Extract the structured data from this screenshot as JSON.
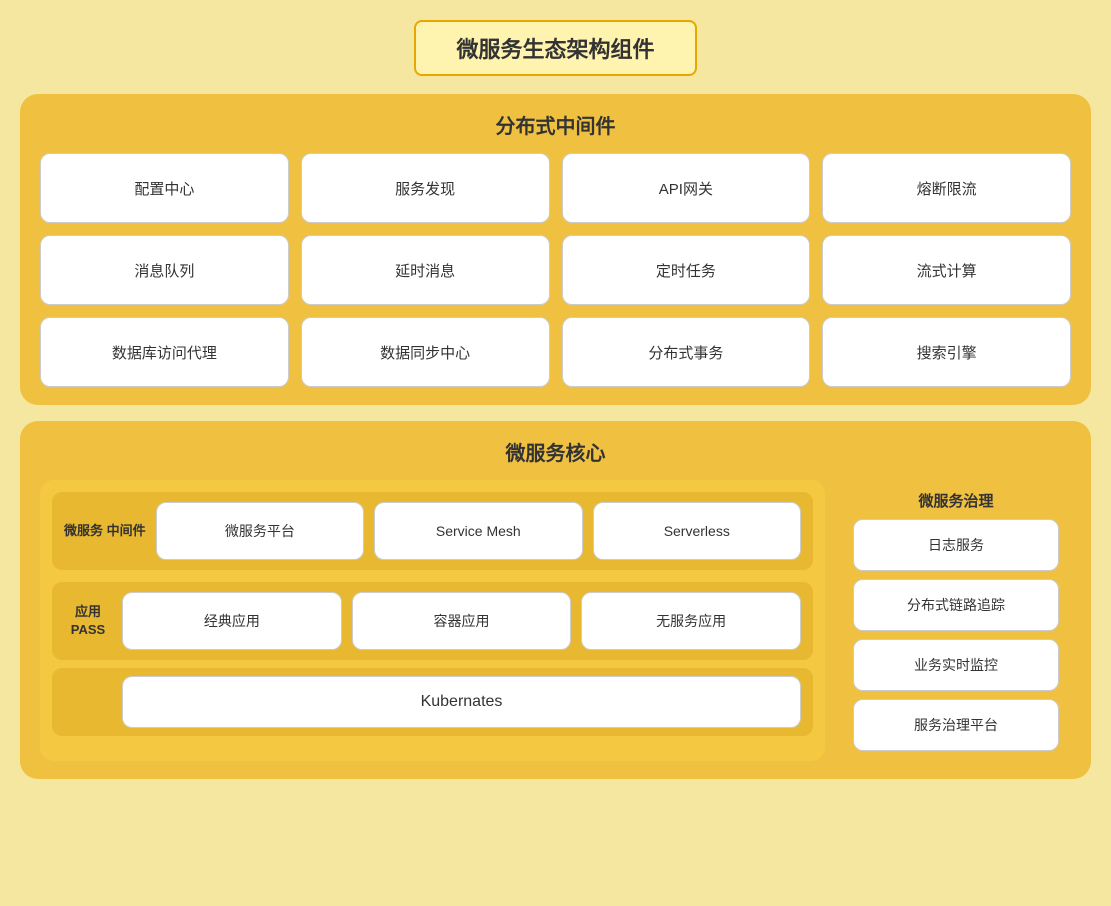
{
  "pageTitle": "微服务生态架构组件",
  "distributedSection": {
    "title": "分布式中间件",
    "cards": [
      "配置中心",
      "服务发现",
      "API网关",
      "熔断限流",
      "消息队列",
      "延时消息",
      "定时任务",
      "流式计算",
      "数据库访问代理",
      "数据同步中心",
      "分布式事务",
      "搜索引擎"
    ]
  },
  "microserviceSection": {
    "title": "微服务核心",
    "middlewareRow": {
      "label": "微服务\n中间件",
      "cards": [
        "微服务平台",
        "Service Mesh",
        "Serverless"
      ]
    },
    "passRow": {
      "label": "应用\nPASS",
      "cards": [
        "经典应用",
        "容器应用",
        "无服务应用"
      ]
    },
    "kubernetes": "Kubernates",
    "governance": {
      "title": "微服务治理",
      "items": [
        "日志服务",
        "分布式链路追踪",
        "业务实时监控",
        "服务治理平台"
      ]
    }
  }
}
